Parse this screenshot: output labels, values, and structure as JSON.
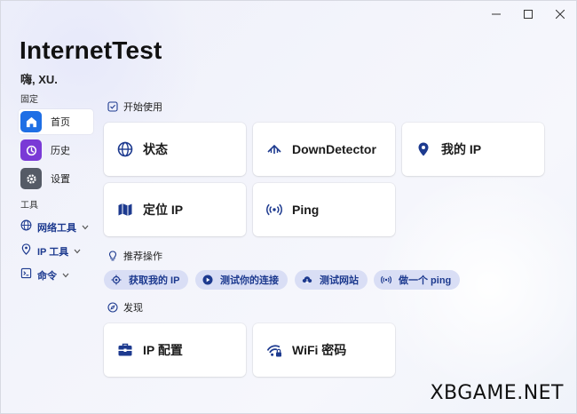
{
  "app": {
    "title": "InternetTest",
    "greeting": "嗨, XU."
  },
  "window_controls": {
    "minimize": "—",
    "maximize": "☐",
    "close": "✕"
  },
  "sidebar": {
    "pinned_label": "固定",
    "pinned": [
      {
        "label": "首页",
        "icon": "home-icon",
        "color": "#1f6fe5"
      },
      {
        "label": "历史",
        "icon": "history-icon",
        "color": "#7a3ad6"
      },
      {
        "label": "设置",
        "icon": "gear-icon",
        "color": "#555b66"
      }
    ],
    "tools_label": "工具",
    "tools": [
      {
        "label": "网络工具",
        "icon": "globe-icon"
      },
      {
        "label": "IP 工具",
        "icon": "location-pin-icon"
      },
      {
        "label": "命令",
        "icon": "command-icon"
      }
    ]
  },
  "main": {
    "get_started": {
      "header": "开始使用",
      "cards": [
        {
          "label": "状态",
          "icon": "globe-icon"
        },
        {
          "label": "DownDetector",
          "icon": "signal-icon"
        },
        {
          "label": "我的 IP",
          "icon": "location-pin-icon"
        },
        {
          "label": "定位 IP",
          "icon": "map-icon"
        },
        {
          "label": "Ping",
          "icon": "broadcast-icon"
        }
      ]
    },
    "recommended": {
      "header": "推荐操作",
      "chips": [
        {
          "label": "获取我的 IP",
          "icon": "target-icon"
        },
        {
          "label": "测试你的连接",
          "icon": "play-icon"
        },
        {
          "label": "测试网站",
          "icon": "cloud-icon"
        },
        {
          "label": "做一个 ping",
          "icon": "broadcast-icon"
        }
      ]
    },
    "discover": {
      "header": "发现",
      "cards": [
        {
          "label": "IP 配置",
          "icon": "toolbox-icon"
        },
        {
          "label": "WiFi 密码",
          "icon": "wifi-lock-icon"
        }
      ]
    }
  },
  "watermark": "XBGAME.NET",
  "colors": {
    "accent": "#1d3a8f",
    "chip_bg": "#d9def5"
  }
}
